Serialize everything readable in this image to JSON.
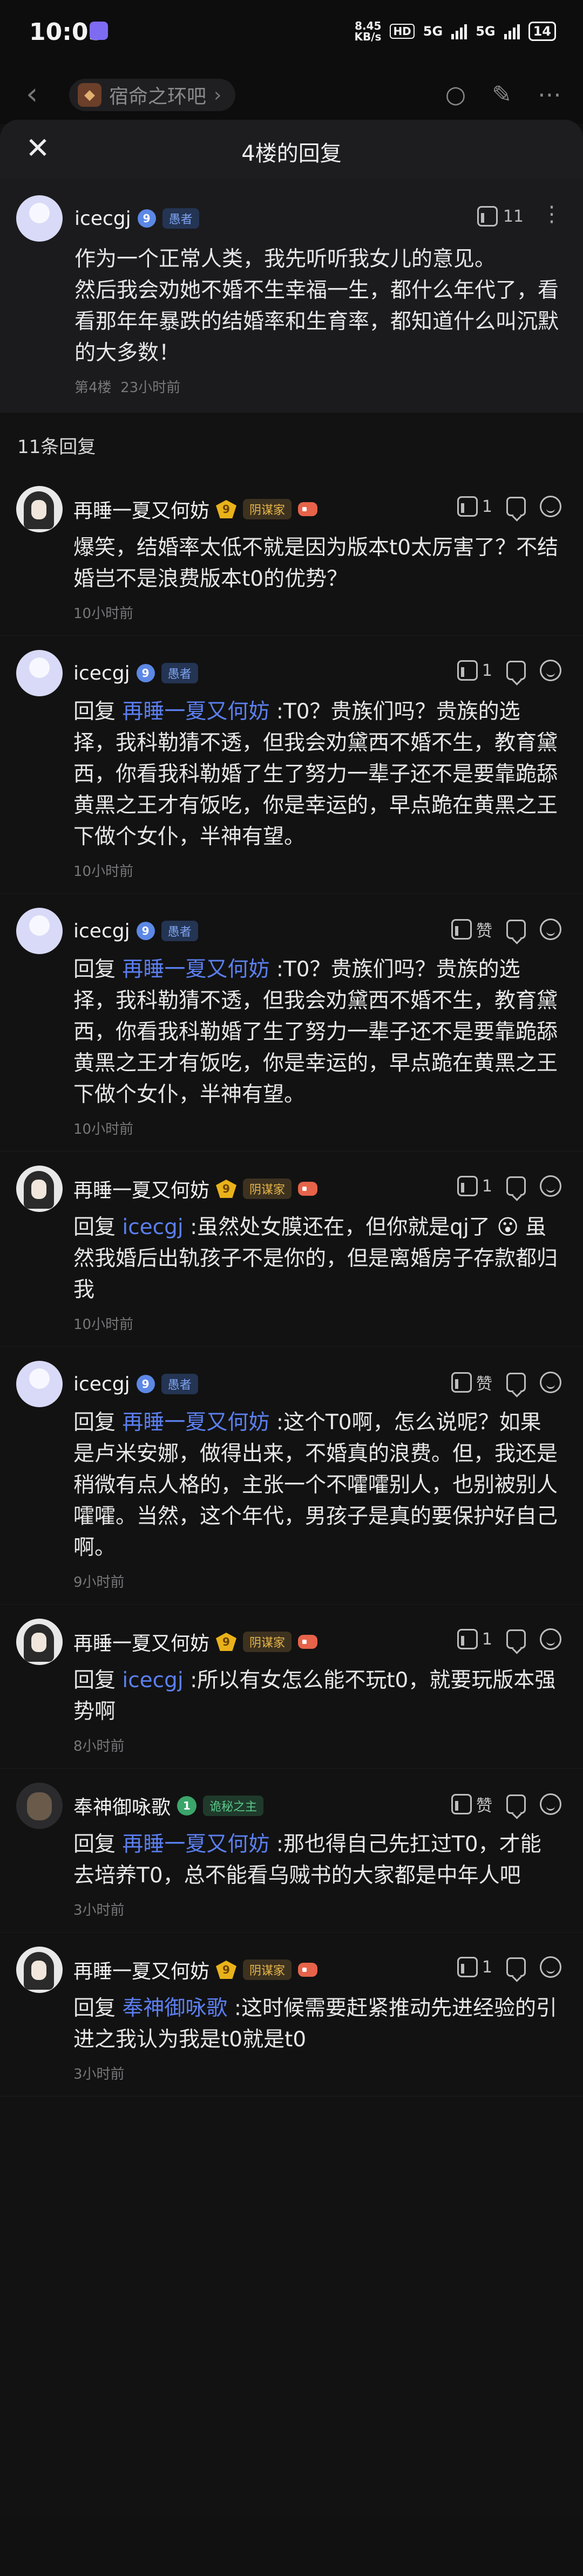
{
  "status_bar": {
    "time": "10:05",
    "net_speed_top": "8.45",
    "net_speed_bottom": "KB/s",
    "hd": "HD",
    "net1": "5G",
    "net2": "5G",
    "battery": "14"
  },
  "topnav": {
    "forum_name": "宿命之环吧",
    "forum_chevron": "›"
  },
  "sheet": {
    "title": "4楼的回复",
    "close_icon": "close-icon"
  },
  "main_post": {
    "user": "icecgj",
    "level": "9",
    "tag": "愚者",
    "likes": "11",
    "text": "作为一个正常人类，我先听听我女儿的意见。\n然后我会劝她不婚不生幸福一生，都什么年代了，看看那年年暴跌的结婚率和生育率，都知道什么叫沉默的大多数！",
    "floor": "第4楼",
    "time": "23小时前"
  },
  "reply_count": "11条回复",
  "replies": [
    {
      "user": "再睡一夏又何妨",
      "level": "9",
      "tag": "阴谋家",
      "likes": "1",
      "prefix": "",
      "mention": "",
      "text": "爆笑，结婚率太低不就是因为版本t0太厉害了？不结婚岂不是浪费版本t0的优势？",
      "time": "10小时前"
    },
    {
      "user": "icecgj",
      "level": "9",
      "tag": "愚者",
      "likes": "1",
      "prefix": "回复 ",
      "mention": "再睡一夏又何妨",
      "text": " :T0？贵族们吗？贵族的选择，我科勒猜不透，但我会劝黛西不婚不生，教育黛西，你看我科勒婚了生了努力一辈子还不是要靠跪舔黄黑之王才有饭吃，你是幸运的，早点跪在黄黑之王下做个女仆，半神有望。",
      "time": "10小时前"
    },
    {
      "user": "icecgj",
      "level": "9",
      "tag": "愚者",
      "likes": "赞",
      "prefix": "回复 ",
      "mention": "再睡一夏又何妨",
      "text": " :T0？贵族们吗？贵族的选择，我科勒猜不透，但我会劝黛西不婚不生，教育黛西，你看我科勒婚了生了努力一辈子还不是要靠跪舔黄黑之王才有饭吃，你是幸运的，早点跪在黄黑之王下做个女仆，半神有望。",
      "time": "10小时前"
    },
    {
      "user": "再睡一夏又何妨",
      "level": "9",
      "tag": "阴谋家",
      "likes": "1",
      "prefix": "回复 ",
      "mention": "icecgj",
      "text": " :虽然处女膜还在，但你就是qj了 😮 虽然我婚后出轨孩子不是你的，但是离婚房子存款都归我",
      "time": "10小时前"
    },
    {
      "user": "icecgj",
      "level": "9",
      "tag": "愚者",
      "likes": "赞",
      "prefix": "回复 ",
      "mention": "再睡一夏又何妨",
      "text": " :这个T0啊，怎么说呢？如果是卢米安娜，做得出来，不婚真的浪费。但，我还是稍微有点人格的，主张一个不嚯嚯别人，也别被别人嚯嚯。当然，这个年代，男孩子是真的要保护好自己啊。",
      "time": "9小时前"
    },
    {
      "user": "再睡一夏又何妨",
      "level": "9",
      "tag": "阴谋家",
      "likes": "1",
      "prefix": "回复 ",
      "mention": "icecgj",
      "text": " :所以有女怎么能不玩t0，就要玩版本强势啊",
      "time": "8小时前"
    },
    {
      "user": "奉神御咏歌",
      "level": "1",
      "tag": "诡秘之主",
      "likes": "赞",
      "prefix": "回复 ",
      "mention": "再睡一夏又何妨",
      "text": " :那也得自己先扛过T0，才能去培养T0，总不能看乌贼书的大家都是中年人吧",
      "time": "3小时前"
    },
    {
      "user": "再睡一夏又何妨",
      "level": "9",
      "tag": "阴谋家",
      "likes": "1",
      "prefix": "回复 ",
      "mention": "奉神御咏歌",
      "text": " :这时候需要赶紧推动先进经验的引进之我认为我是t0就是t0",
      "time": "3小时前"
    }
  ]
}
